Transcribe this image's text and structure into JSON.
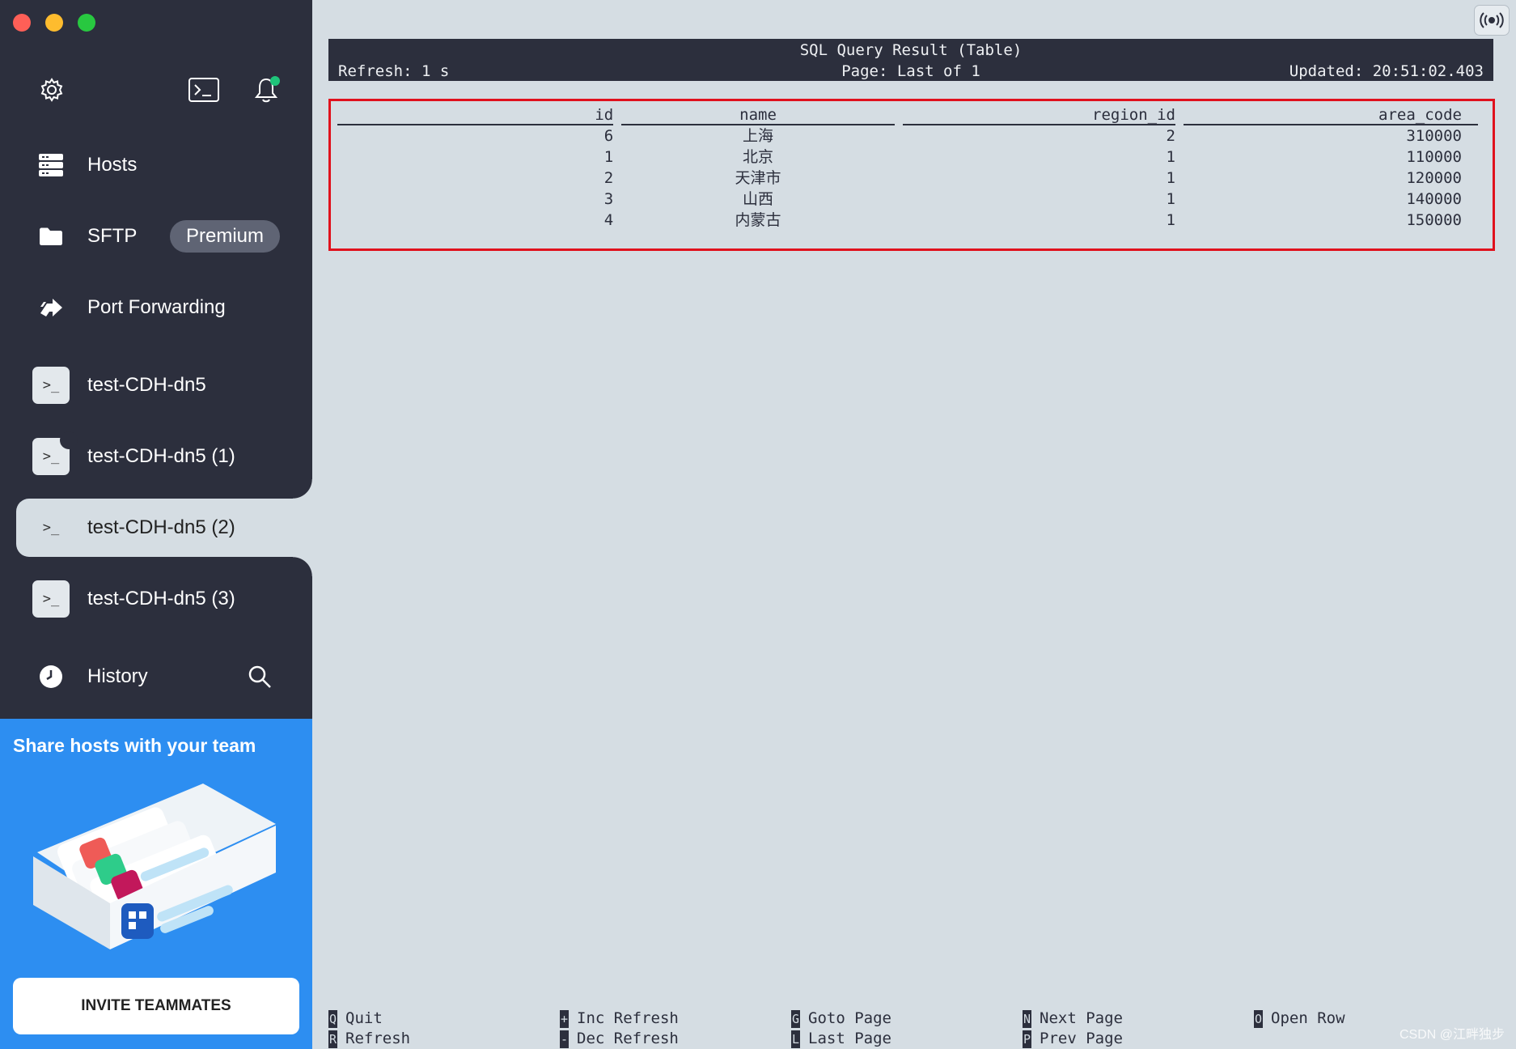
{
  "sidebar": {
    "top_icons": [
      "gear-icon",
      "terminal-icon",
      "bell-icon"
    ],
    "nav": [
      {
        "label": "Hosts",
        "icon": "hosts-icon"
      },
      {
        "label": "SFTP",
        "icon": "folder-icon",
        "badge": "Premium"
      },
      {
        "label": "Port Forwarding",
        "icon": "port-forwarding-icon"
      }
    ],
    "sessions": [
      {
        "label": "test-CDH-dn5"
      },
      {
        "label": "test-CDH-dn5 (1)"
      },
      {
        "label": "test-CDH-dn5 (2)",
        "active": true
      },
      {
        "label": "test-CDH-dn5 (3)"
      }
    ],
    "history_label": "History",
    "promo": {
      "title": "Share hosts with your team",
      "button": "INVITE TEAMMATES"
    }
  },
  "terminal": {
    "header": {
      "title": "SQL Query Result (Table)",
      "refresh": "Refresh: 1 s",
      "page": "Page: Last of 1",
      "updated": "Updated: 20:51:02.403"
    },
    "columns": [
      "id",
      "name",
      "region_id",
      "area_code"
    ],
    "rows": [
      [
        "6",
        "上海",
        "2",
        "310000"
      ],
      [
        "1",
        "北京",
        "1",
        "110000"
      ],
      [
        "2",
        "天津市",
        "1",
        "120000"
      ],
      [
        "3",
        "山西",
        "1",
        "140000"
      ],
      [
        "4",
        "内蒙古",
        "1",
        "150000"
      ]
    ],
    "keys": [
      {
        "k1": "Q",
        "l1": "Quit",
        "k2": "R",
        "l2": "Refresh"
      },
      {
        "k1": "+",
        "l1": "Inc Refresh",
        "k2": "-",
        "l2": "Dec Refresh"
      },
      {
        "k1": "G",
        "l1": "Goto Page",
        "k2": "L",
        "l2": "Last Page"
      },
      {
        "k1": "N",
        "l1": "Next Page",
        "k2": "P",
        "l2": "Prev Page"
      },
      {
        "k1": "O",
        "l1": "Open Row",
        "k2": "",
        "l2": ""
      }
    ]
  },
  "watermark": "CSDN @江畔独步",
  "colors": {
    "sidebar_bg": "#2c2f3d",
    "main_bg": "#d5dde3",
    "promo_bg": "#2d8ef1",
    "highlight_border": "#e0111d",
    "notification_dot": "#1fc47a"
  }
}
